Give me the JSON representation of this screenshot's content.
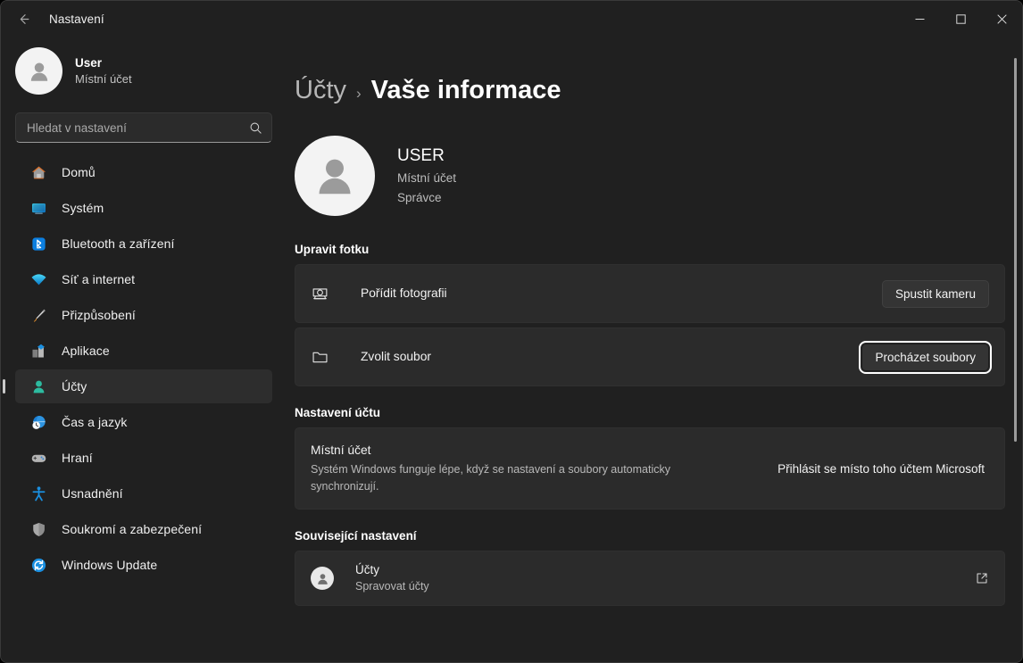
{
  "window": {
    "title": "Nastavení",
    "back_label": "back-arrow",
    "minimize_label": "Minimalizovat",
    "maximize_label": "Maximalizovat",
    "close_label": "Zavřít"
  },
  "sidebar": {
    "profile": {
      "name": "User",
      "account_type": "Místní účet"
    },
    "search": {
      "placeholder": "Hledat v nastavení",
      "value": "",
      "icon": "search-icon"
    },
    "items": [
      {
        "label": "Domů",
        "icon": "home-icon",
        "active": false
      },
      {
        "label": "Systém",
        "icon": "system-icon",
        "active": false
      },
      {
        "label": "Bluetooth a zařízení",
        "icon": "bluetooth-icon",
        "active": false
      },
      {
        "label": "Síť a internet",
        "icon": "wifi-icon",
        "active": false
      },
      {
        "label": "Přizpůsobení",
        "icon": "brush-icon",
        "active": false
      },
      {
        "label": "Aplikace",
        "icon": "apps-icon",
        "active": false
      },
      {
        "label": "Účty",
        "icon": "accounts-icon",
        "active": true
      },
      {
        "label": "Čas a jazyk",
        "icon": "clock-globe-icon",
        "active": false
      },
      {
        "label": "Hraní",
        "icon": "gamepad-icon",
        "active": false
      },
      {
        "label": "Usnadnění",
        "icon": "accessibility-icon",
        "active": false
      },
      {
        "label": "Soukromí a zabezpečení",
        "icon": "shield-icon",
        "active": false
      },
      {
        "label": "Windows Update",
        "icon": "update-icon",
        "active": false
      }
    ]
  },
  "main": {
    "breadcrumb": {
      "parent": "Účty",
      "separator": "›",
      "current": "Vaše informace"
    },
    "hero": {
      "name": "USER",
      "account_type": "Místní účet",
      "role": "Správce",
      "avatar": "person-avatar"
    },
    "sections": [
      {
        "title": "Upravit fotku",
        "rows": [
          {
            "icon": "camera-icon",
            "title": "Pořídit fotografii",
            "action_label": "Spustit kameru",
            "focused": false
          },
          {
            "icon": "folder-icon",
            "title": "Zvolit soubor",
            "action_label": "Procházet soubory",
            "focused": true
          }
        ]
      },
      {
        "title": "Nastavení účtu",
        "row": {
          "title": "Místní účet",
          "description": "Systém Windows funguje lépe, když se nastavení a soubory automaticky synchronizují.",
          "action_label": "Přihlásit se místo toho účtem Microsoft"
        }
      },
      {
        "title": "Související nastavení",
        "row": {
          "icon": "accounts-badge-icon",
          "title": "Účty",
          "description": "Spravovat účty",
          "trailing_icon": "external-link-icon"
        }
      }
    ]
  },
  "colors": {
    "window_bg": "#202020",
    "card_bg": "#2b2b2b",
    "accent_teal": "#2dbba0",
    "accent_blue": "#0a84d8",
    "text_primary": "#ffffff",
    "text_secondary": "#bcbcbc",
    "selection_indicator": "#c9c9c9"
  }
}
